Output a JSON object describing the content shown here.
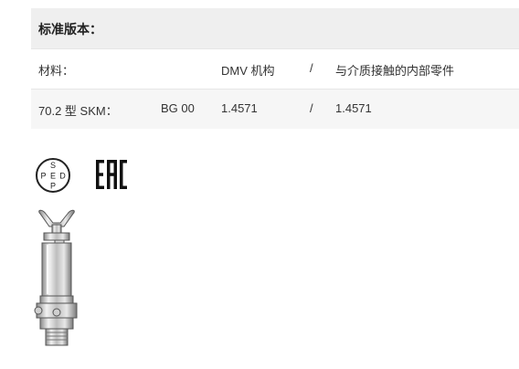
{
  "spec": {
    "header": "标准版本：",
    "rows": [
      {
        "c1": "材料：",
        "c2": "",
        "c3": "DMV 机构",
        "c4": "/",
        "c5": "与介质接触的内部零件"
      },
      {
        "c1": "70.2 型 SKM：",
        "c2": "BG 00",
        "c3": "1.4571",
        "c4": "/",
        "c5": "1.4571"
      }
    ]
  },
  "certifications": {
    "ped": {
      "top": "S",
      "left": "P",
      "center": "E",
      "right": "D",
      "bottom": "P"
    },
    "eac": "EAC"
  },
  "colors": {
    "header_bg": "#efefef",
    "row_alt_bg": "#f6f6f6",
    "divider": "#e6e6e6",
    "text": "#333333"
  },
  "icons": {
    "ped_logo": "ped-pressure-equipment-logo",
    "eac_logo": "eac-conformity-mark",
    "product": "pressure-relief-valve-image"
  }
}
